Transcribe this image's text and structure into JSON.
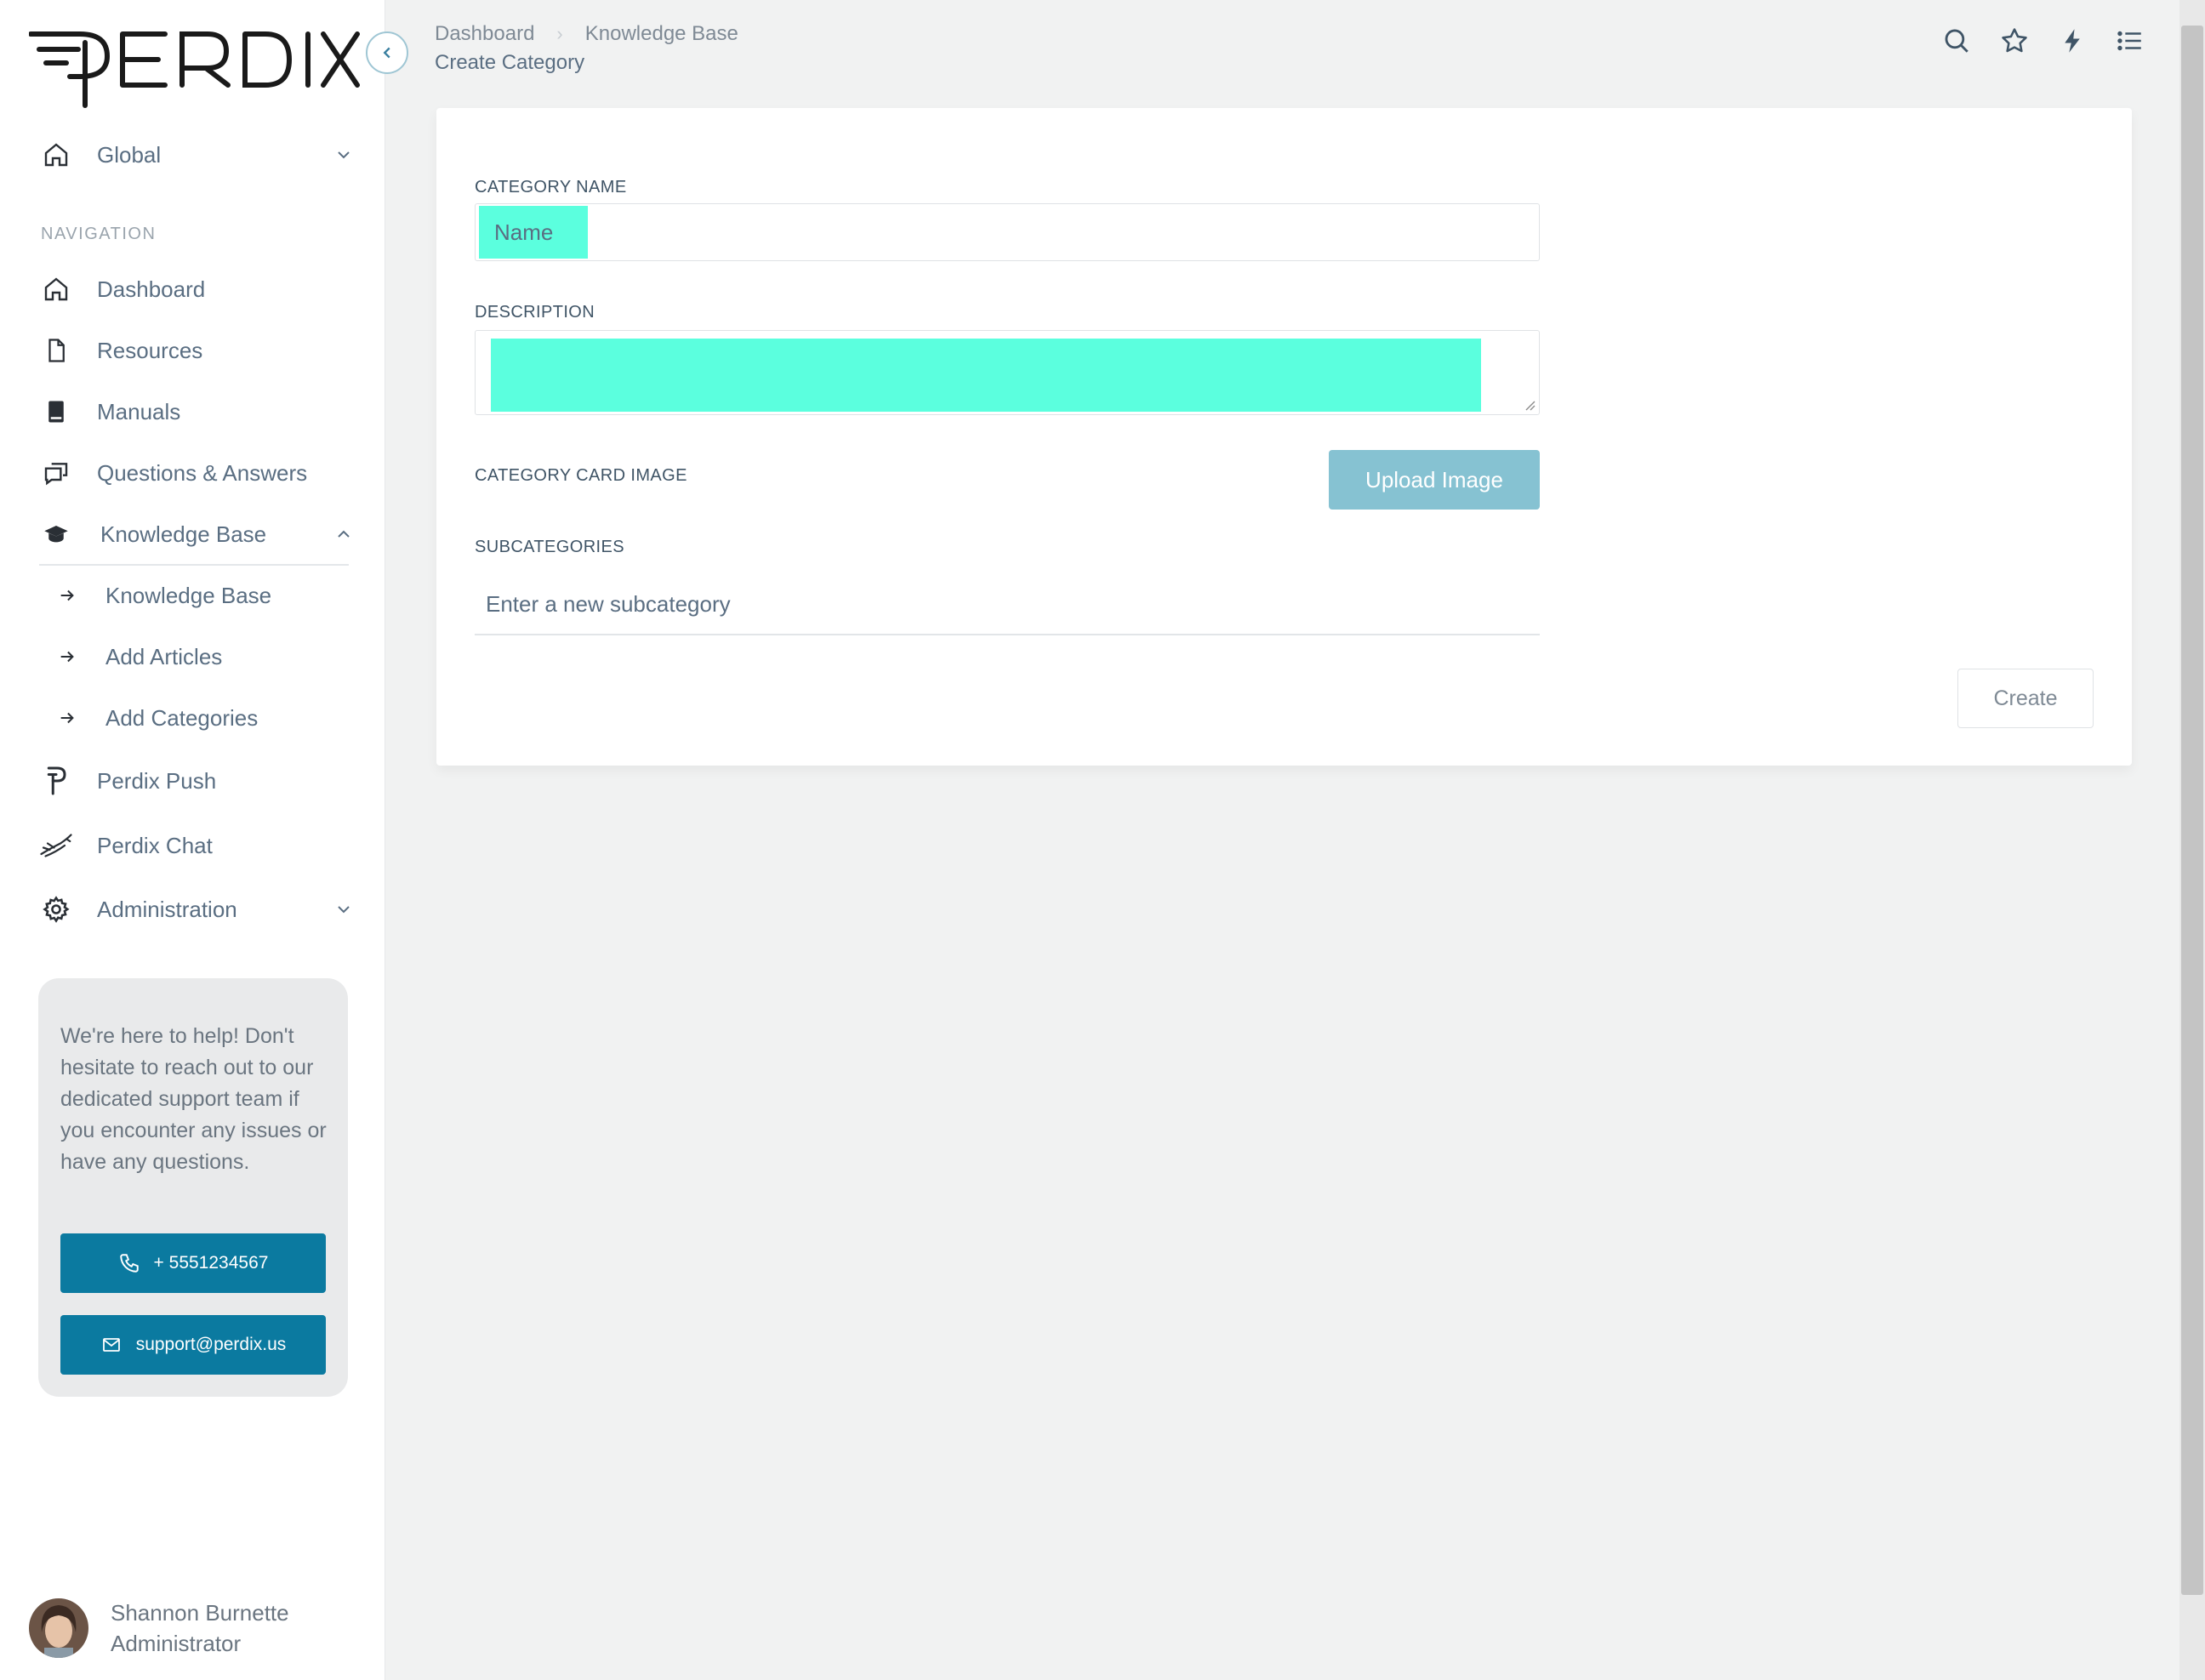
{
  "brand": {
    "logo_text": "PERDIX"
  },
  "sidebar": {
    "global_label": "Global",
    "nav_heading": "NAVIGATION",
    "items": [
      {
        "label": "Dashboard"
      },
      {
        "label": "Resources"
      },
      {
        "label": "Manuals"
      },
      {
        "label": "Questions & Answers"
      },
      {
        "label": "Knowledge Base"
      },
      {
        "label": "Perdix Push"
      },
      {
        "label": "Perdix Chat"
      },
      {
        "label": "Administration"
      }
    ],
    "knowledge_base_sub": [
      {
        "label": "Knowledge Base"
      },
      {
        "label": "Add Articles"
      },
      {
        "label": "Add Categories"
      }
    ],
    "help": {
      "text": "We're here to help! Don't hesitate to reach out to our dedicated support team if you encounter any issues or have any questions.",
      "phone": "+ 5551234567",
      "email": "support@perdix.us"
    },
    "user": {
      "name": "Shannon Burnette",
      "role": "Administrator"
    }
  },
  "breadcrumb": {
    "items": [
      "Dashboard",
      "Knowledge Base"
    ],
    "page_subtitle": "Create Category"
  },
  "form": {
    "category_name_label": "CATEGORY NAME",
    "category_name_placeholder": "Name",
    "description_label": "DESCRIPTION",
    "card_image_label": "CATEGORY CARD IMAGE",
    "upload_label": "Upload Image",
    "subcategories_label": "SUBCATEGORIES",
    "subcategory_placeholder": "Enter a new subcategory",
    "create_label": "Create"
  },
  "colors": {
    "accent": "#0b7aa0",
    "upload_button": "#86c2d2",
    "highlight": "#5bffde"
  },
  "icons": [
    "search-icon",
    "star-icon",
    "lightning-icon",
    "list-icon"
  ]
}
